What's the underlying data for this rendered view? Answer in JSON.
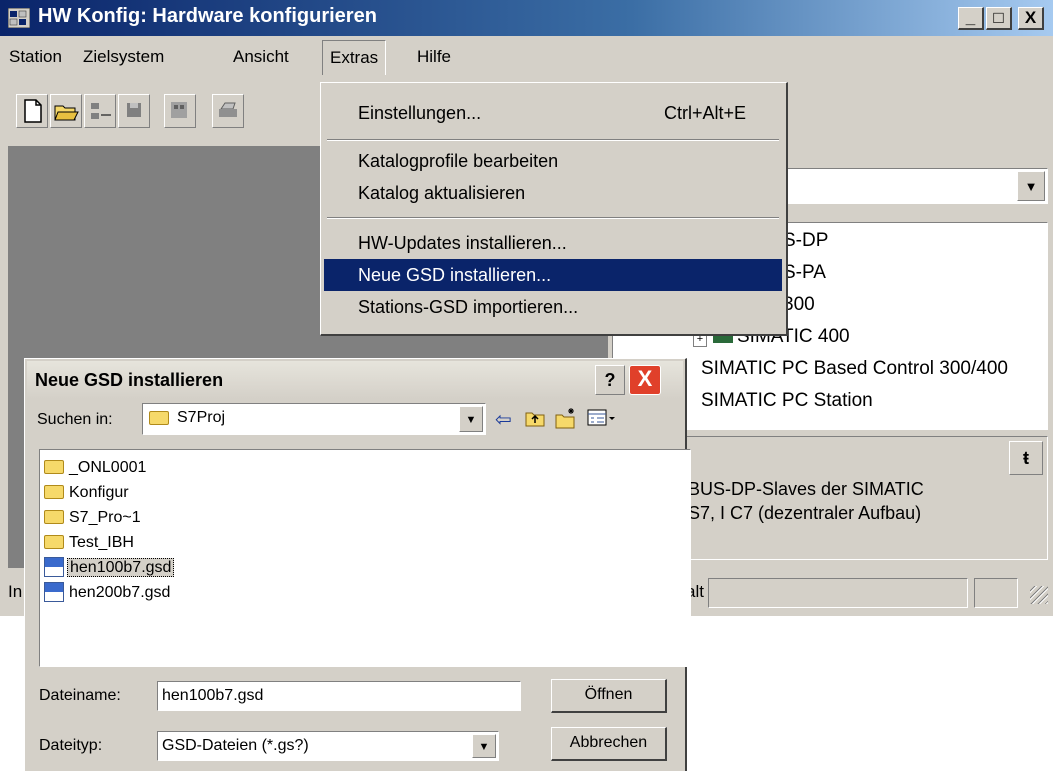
{
  "window": {
    "title": "HW Konfig: Hardware konfigurieren",
    "buttons": {
      "minimize": "_",
      "maximize": "□",
      "close": "X"
    }
  },
  "menubar": {
    "items": [
      "Station",
      "Zielsystem",
      "Ansicht",
      "Extras",
      "Hilfe"
    ]
  },
  "extras_menu": {
    "items": [
      {
        "label": "Einstellungen...",
        "accel": "Ctrl+Alt+E"
      },
      {
        "label": "Katalogprofile bearbeiten",
        "accel": ""
      },
      {
        "label": "Katalog aktualisieren",
        "accel": ""
      },
      {
        "label": "HW-Updates installieren...",
        "accel": ""
      },
      {
        "label": "Neue GSD installieren...",
        "accel": ""
      },
      {
        "label": "Stations-GSD importieren...",
        "accel": ""
      }
    ]
  },
  "catalog": {
    "tree": [
      "S-DP",
      "S-PA",
      "300",
      "SIMATIC 400",
      "SIMATIC PC Based Control 300/400",
      "SIMATIC PC Station"
    ],
    "description": "BUS-DP-Slaves der SIMATIC S7, I C7 (dezentraler Aufbau)"
  },
  "statusbar": {
    "left": "In",
    "right_label": "alt"
  },
  "dialog": {
    "title": "Neue GSD installieren",
    "help": "?",
    "close": "X",
    "lookin_label": "Suchen in:",
    "lookin_value": "S7Proj",
    "files": [
      {
        "name": "_ONL0001",
        "kind": "folder"
      },
      {
        "name": "Konfigur",
        "kind": "folder"
      },
      {
        "name": "S7_Pro~1",
        "kind": "folder"
      },
      {
        "name": "Test_IBH",
        "kind": "folder"
      },
      {
        "name": "hen100b7.gsd",
        "kind": "gsd"
      },
      {
        "name": "hen200b7.gsd",
        "kind": "gsd"
      }
    ],
    "filename_label": "Dateiname:",
    "filename_value": "hen100b7.gsd",
    "filetype_label": "Dateityp:",
    "filetype_value": "GSD-Dateien (*.gs?)",
    "open_button": "Öffnen",
    "cancel_button": "Abbrechen"
  }
}
